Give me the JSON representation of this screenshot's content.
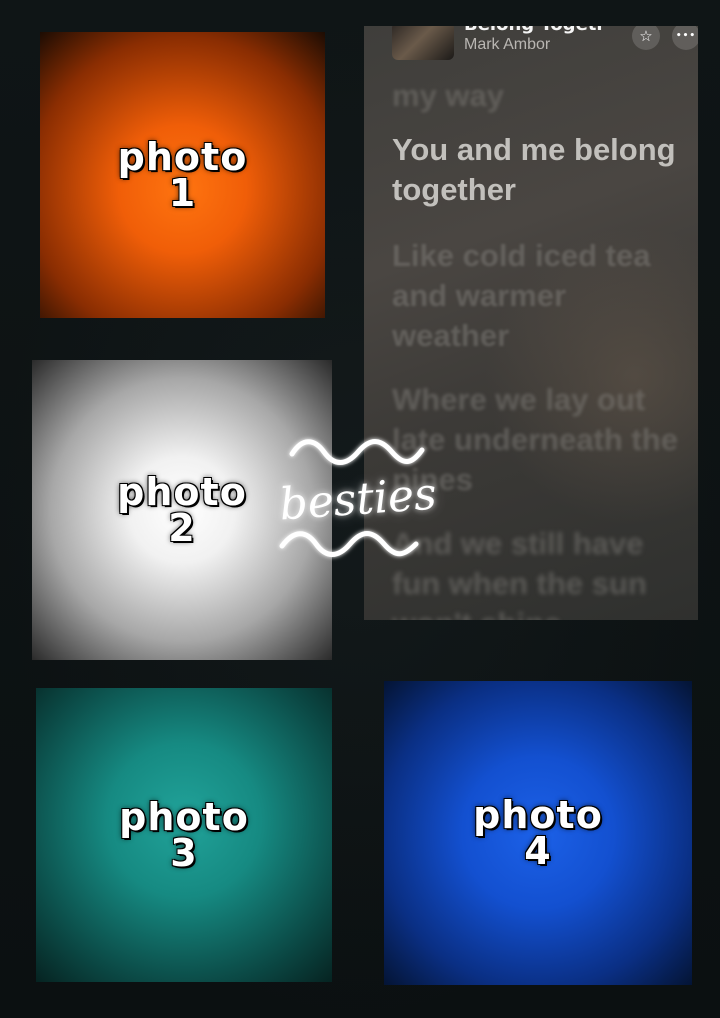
{
  "tiles": [
    {
      "id": "photo1",
      "word": "photo",
      "number": "1"
    },
    {
      "id": "photo2",
      "word": "photo",
      "number": "2"
    },
    {
      "id": "photo3",
      "word": "photo",
      "number": "3"
    },
    {
      "id": "photo4",
      "word": "photo",
      "number": "4"
    }
  ],
  "music": {
    "title": "Belong Together",
    "artist": "Mark Ambor",
    "star_icon": "☆",
    "more_icon": "•••",
    "lyric_prev": "my way",
    "lyric_current": "You and me belong together",
    "lyric_next_1": "Like cold iced tea and warmer weather",
    "lyric_next_2": "Where we lay out late underneath the pines",
    "lyric_next_3": "And we still have fun when the sun won't shine"
  },
  "sticker": {
    "text": "besties"
  },
  "colors": {
    "background": "#0c1112",
    "photo1": "#f05e08",
    "photo2": "#f1f1f1",
    "photo3": "#168a82",
    "photo4": "#1350d0"
  }
}
